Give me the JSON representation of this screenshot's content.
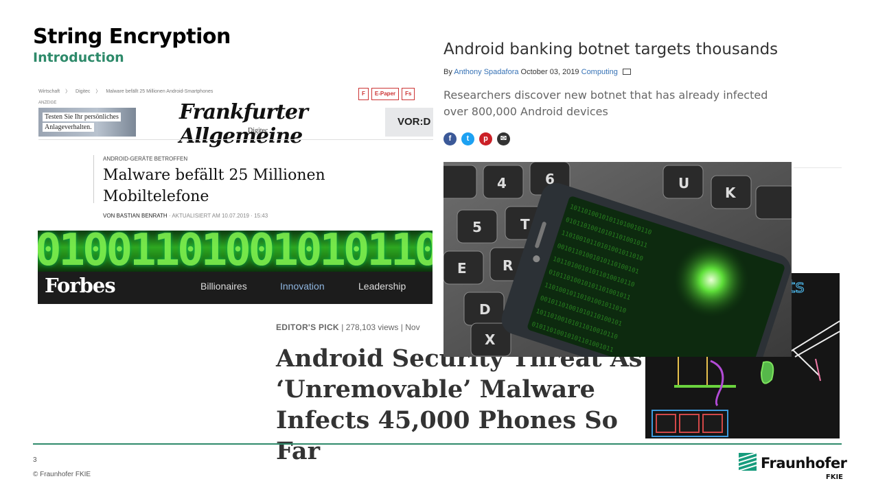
{
  "slide": {
    "title": "String Encryption",
    "subtitle": "Introduction",
    "page_number": "3",
    "copyright": "© Fraunhofer FKIE",
    "logo_name": "Fraunhofer",
    "logo_sub": "FKIE",
    "accent_color": "#2e8a6a"
  },
  "faz": {
    "breadcrumb": [
      "Wirtschaft",
      "〉",
      "Digitec",
      "〉",
      "Malware befällt 25 Millionen Android-Smartphones"
    ],
    "icon_f": "F",
    "icon_epaper": "E-Paper",
    "icon_fs": "Fs",
    "anzeige": "ANZEIGE",
    "ad_line1": "Testen Sie Ihr persönliches",
    "ad_line2": "Anlageverhalten.",
    "logo": "Frankfurter Allgemeine",
    "section": "Digitec",
    "ad2": "VOR:D",
    "kicker": "ANDROID-GERÄTE BETROFFEN",
    "headline": "Malware befällt 25 Millionen Mobiltelefone",
    "byline_author": "VON BASTIAN BENRATH",
    "byline_sep": "·",
    "byline_updated": "AKTUALISIERT AM 10.07.2019",
    "byline_time": "15:43"
  },
  "binary_strip": "01001101001010110",
  "forbes": {
    "logo": "Forbes",
    "nav": [
      "Billionaires",
      "Innovation",
      "Leadership"
    ],
    "meta_pick": "EDITOR'S PICK",
    "meta_views": "278,103 views",
    "meta_date": "Nov",
    "meta_sep": "|",
    "headline": "Android Security Threat As ‘Unremovable’ Malware Infects 45,000 Phones So Far"
  },
  "techradar": {
    "headline": "Android banking botnet targets thousands",
    "by": "By",
    "author": "Anthony Spadafora",
    "date": "October 03, 2019",
    "category": "Computing",
    "summary": "Researchers discover new botnet that has already infected over 800,000 Android devices",
    "share_icons": [
      "f",
      "t",
      "p",
      "✉"
    ]
  },
  "dark_image": {
    "text": "ts"
  }
}
